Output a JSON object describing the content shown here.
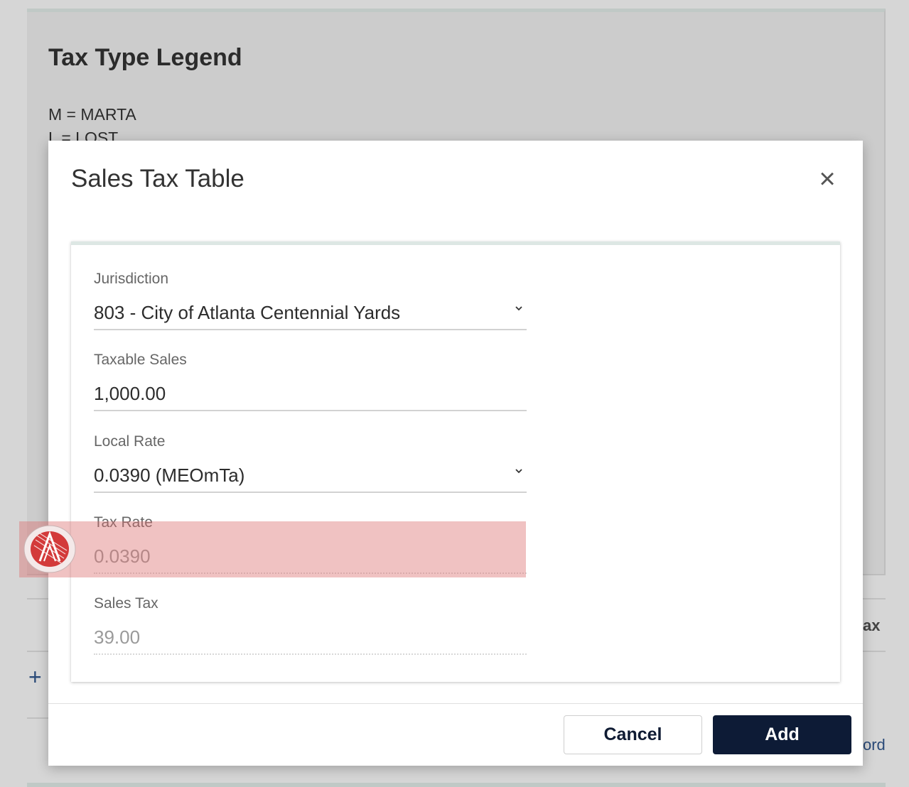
{
  "background": {
    "title": "Tax Type Legend",
    "legend": [
      "M = MARTA",
      "L = LOST"
    ],
    "table_header_fragment": "ax",
    "link_fragment": "ord",
    "plus": "+"
  },
  "modal": {
    "title": "Sales Tax Table",
    "close_icon": "close-icon",
    "fields": {
      "jurisdiction": {
        "label": "Jurisdiction",
        "value": "803 - City of Atlanta Centennial Yards"
      },
      "taxable_sales": {
        "label": "Taxable Sales",
        "value": "1,000.00"
      },
      "local_rate": {
        "label": "Local Rate",
        "value": "0.0390 (MEOmTa)"
      },
      "tax_rate": {
        "label": "Tax Rate",
        "value": "0.0390"
      },
      "sales_tax": {
        "label": "Sales Tax",
        "value": "39.00"
      }
    },
    "buttons": {
      "cancel": "Cancel",
      "add": "Add"
    }
  },
  "colors": {
    "primary": "#0d1b36",
    "highlight": "#e0a0a0",
    "logo_red": "#d33a3a"
  }
}
